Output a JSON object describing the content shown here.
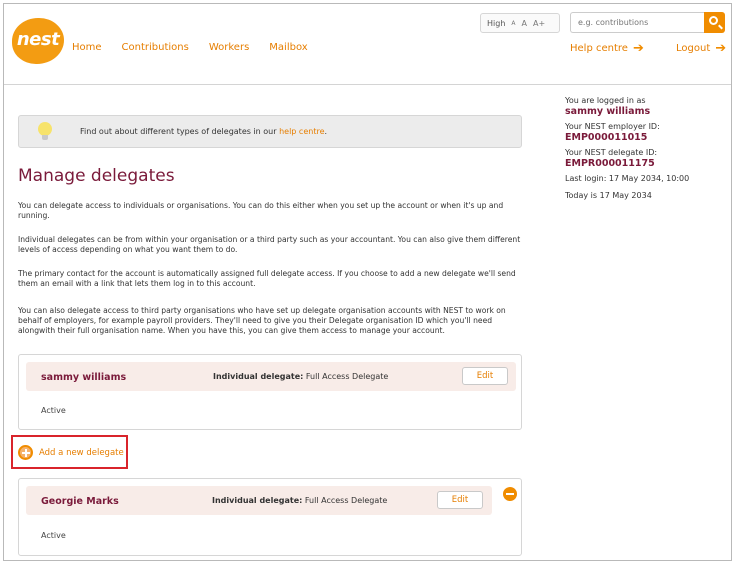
{
  "header": {
    "logo_text": "nest",
    "nav": [
      "Home",
      "Contributions",
      "Workers",
      "Mailbox"
    ],
    "text_size": {
      "label": "High",
      "options": [
        "A",
        "A",
        "A+"
      ]
    },
    "search": {
      "placeholder": "e.g. contributions"
    },
    "help_link": "Help centre",
    "logout_link": "Logout"
  },
  "banner": {
    "text": "Find out about different types of delegates in our ",
    "link": "help centre",
    "end": "."
  },
  "page_title": "Manage delegates",
  "paragraphs": [
    "You can delegate access to individuals or organisations. You can do this either when you set up the account or when it's up and running.",
    "Individual delegates can be from within your organisation or a third party such as your accountant. You can also give them different levels of access depending on what you want them to do.",
    "The primary contact for the account is automatically assigned full delegate access. If you choose to add a new delegate we'll send them an email with a link that lets them log in to this account.",
    "You can also delegate access to third party organisations who have set up delegate organisation accounts with NEST to work on behalf of employers, for example payroll providers. They'll need to give you their Delegate organisation ID which you'll need alongwith their full organisation name. When you have this, you can give them access to manage your account."
  ],
  "delegates": [
    {
      "name": "sammy williams",
      "type_label": "Individual delegate:",
      "type_value": "Full Access Delegate",
      "edit_label": "Edit",
      "status": "Active"
    },
    {
      "name": "Georgie Marks",
      "type_label": "Individual delegate:",
      "type_value": "Full Access Delegate",
      "edit_label": "Edit",
      "status": "Active"
    }
  ],
  "add_delegate": "Add a new delegate",
  "sidebar": {
    "logged_in_label": "You are logged in as",
    "user_name": "sammy williams",
    "employer_id_label": "Your NEST employer ID:",
    "employer_id": "EMP000011015",
    "delegate_id_label": "Your NEST delegate ID:",
    "delegate_id": "EMPR000011175",
    "last_login": "Last login: 17 May 2034, 10:00",
    "today": "Today is 17 May 2034"
  },
  "colors": {
    "brand": "#f08c00",
    "heading": "#7a1a3a",
    "highlight": "#d9242b"
  }
}
